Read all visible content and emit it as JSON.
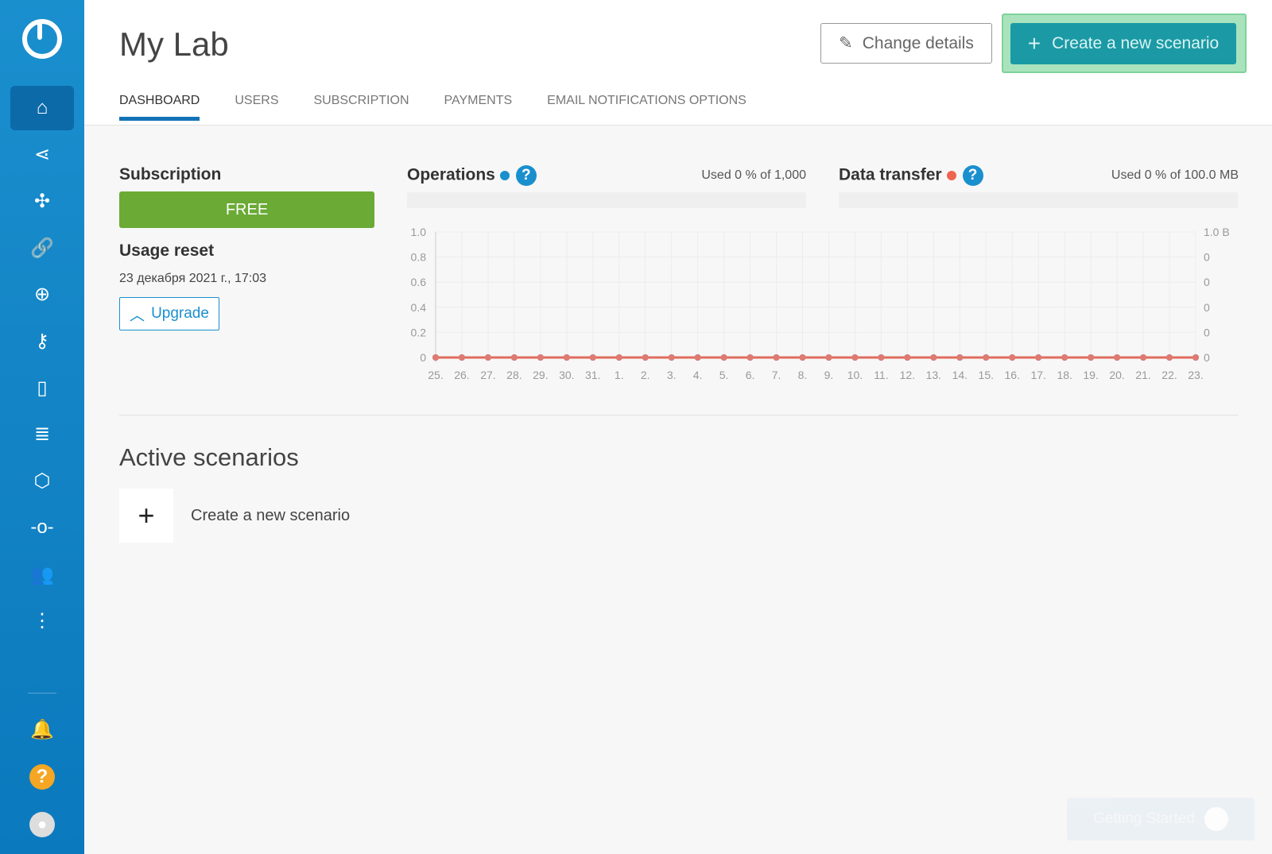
{
  "sidebar": {
    "items": [
      {
        "icon": "home-icon",
        "glyph": "⌂"
      },
      {
        "icon": "share-icon",
        "glyph": "⋖"
      },
      {
        "icon": "puzzle-icon",
        "glyph": "✣"
      },
      {
        "icon": "link-icon",
        "glyph": "🔗"
      },
      {
        "icon": "globe-icon",
        "glyph": "⊕"
      },
      {
        "icon": "key-icon",
        "glyph": "⚷"
      },
      {
        "icon": "device-icon",
        "glyph": "▯"
      },
      {
        "icon": "database-icon",
        "glyph": "≣"
      },
      {
        "icon": "box-icon",
        "glyph": "⬡"
      },
      {
        "icon": "flow-icon",
        "glyph": "-o-"
      },
      {
        "icon": "team-icon",
        "glyph": "👥"
      },
      {
        "icon": "more-icon",
        "glyph": "⋮"
      }
    ],
    "bottom": [
      {
        "icon": "bell-icon",
        "glyph": "🔔"
      },
      {
        "icon": "help-icon",
        "glyph": "?"
      },
      {
        "icon": "avatar-icon",
        "glyph": "●"
      }
    ]
  },
  "header": {
    "title": "My Lab",
    "change_details": "Change details",
    "create_scenario": "Create a new scenario",
    "tabs": [
      "DASHBOARD",
      "USERS",
      "SUBSCRIPTION",
      "PAYMENTS",
      "EMAIL NOTIFICATIONS OPTIONS"
    ]
  },
  "subscription": {
    "title": "Subscription",
    "plan": "FREE",
    "usage_reset_title": "Usage reset",
    "usage_reset_date": "23 декабря 2021 г., 17:03",
    "upgrade": "Upgrade"
  },
  "operations": {
    "title": "Operations",
    "usage": "Used 0 % of 1,000",
    "used_fraction": 0,
    "color": "#1a8fce"
  },
  "data_transfer": {
    "title": "Data transfer",
    "usage": "Used 0 % of 100.0 MB",
    "used_fraction": 0,
    "color": "#f0654f"
  },
  "chart_data": {
    "type": "line",
    "grid": true,
    "categories": [
      "25.",
      "26.",
      "27.",
      "28.",
      "29.",
      "30.",
      "31.",
      "1.",
      "2.",
      "3.",
      "4.",
      "5.",
      "6.",
      "7.",
      "8.",
      "9.",
      "10.",
      "11.",
      "12.",
      "13.",
      "14.",
      "15.",
      "16.",
      "17.",
      "18.",
      "19.",
      "20.",
      "21.",
      "22.",
      "23."
    ],
    "y_left_ticks": [
      "0",
      "0.2",
      "0.4",
      "0.6",
      "0.8",
      "1.0"
    ],
    "y_right_ticks": [
      "0",
      "0",
      "0",
      "0",
      "0",
      "1.0 B"
    ],
    "ylim": [
      0,
      1
    ],
    "series": [
      {
        "name": "Operations",
        "color": "#1a8fce",
        "values": [
          0,
          0,
          0,
          0,
          0,
          0,
          0,
          0,
          0,
          0,
          0,
          0,
          0,
          0,
          0,
          0,
          0,
          0,
          0,
          0,
          0,
          0,
          0,
          0,
          0,
          0,
          0,
          0,
          0,
          0
        ]
      },
      {
        "name": "Data transfer",
        "color": "#f0654f",
        "values": [
          0,
          0,
          0,
          0,
          0,
          0,
          0,
          0,
          0,
          0,
          0,
          0,
          0,
          0,
          0,
          0,
          0,
          0,
          0,
          0,
          0,
          0,
          0,
          0,
          0,
          0,
          0,
          0,
          0,
          0
        ]
      }
    ]
  },
  "active_scenarios": {
    "title": "Active scenarios",
    "create_label": "Create a new scenario"
  },
  "getting_started": {
    "label": "Getting Started"
  }
}
